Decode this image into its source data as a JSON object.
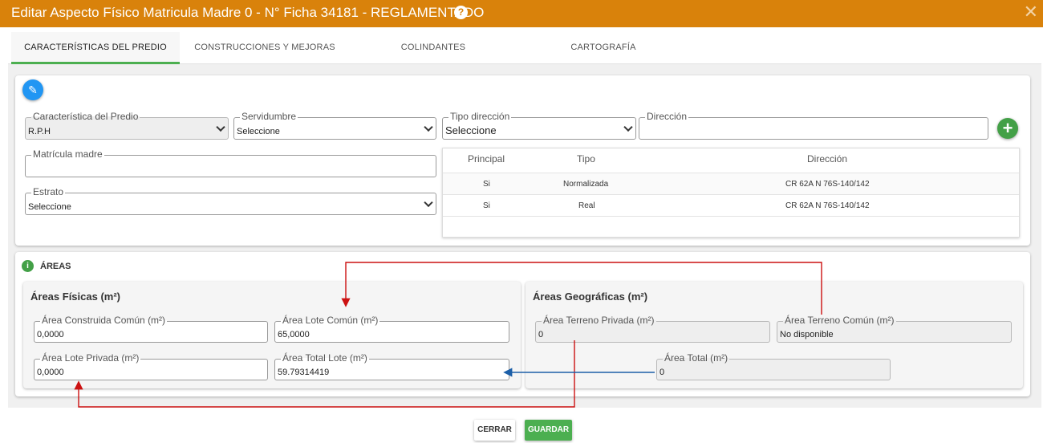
{
  "dialog": {
    "title": "Editar Aspecto Físico Matricula Madre 0 - N° Ficha 34181 - REGLAMENTADO",
    "help_glyph": "?",
    "close_glyph": "✕"
  },
  "tabs": [
    {
      "label": "CARACTERÍSTICAS DEL PREDIO",
      "active": true
    },
    {
      "label": "CONSTRUCCIONES Y MEJORAS",
      "active": false
    },
    {
      "label": "COLINDANTES",
      "active": false
    },
    {
      "label": "CARTOGRAFÍA",
      "active": false
    }
  ],
  "predio": {
    "edit_icon": "pencil-icon",
    "caracteristica": {
      "label": "Característica del Predio",
      "value": "R.P.H"
    },
    "servidumbre": {
      "label": "Servidumbre",
      "value": "Seleccione"
    },
    "tipo_direccion": {
      "label": "Tipo dirección",
      "value": "Seleccione"
    },
    "direccion": {
      "label": "Dirección",
      "value": ""
    },
    "add_glyph": "+",
    "matricula_madre": {
      "label": "Matrícula madre",
      "value": ""
    },
    "estrato": {
      "label": "Estrato",
      "value": "Seleccione"
    }
  },
  "address_table": {
    "columns": [
      "Principal",
      "Tipo",
      "Dirección"
    ],
    "rows": [
      {
        "principal": "Si",
        "tipo": "Normalizada",
        "direccion": "CR 62A N 76S-140/142"
      },
      {
        "principal": "Si",
        "tipo": "Real",
        "direccion": "CR 62A N 76S-140/142"
      }
    ]
  },
  "areas": {
    "section_title": "ÁREAS",
    "info_glyph": "i",
    "fisicas": {
      "title": "Áreas Físicas (m²)",
      "construida_comun": {
        "label": "Área Construida Común (m²)",
        "value": "0,0000"
      },
      "lote_comun": {
        "label": "Área Lote Común (m²)",
        "value": "65,0000"
      },
      "lote_privada": {
        "label": "Área Lote Privada (m²)",
        "value": "0,0000"
      },
      "total_lote": {
        "label": "Área Total Lote (m²)",
        "value": "59.79314419"
      }
    },
    "geograficas": {
      "title": "Áreas Geográficas (m²)",
      "terreno_privada": {
        "label": "Área Terreno Privada (m²)",
        "value": "0"
      },
      "terreno_comun": {
        "label": "Área Terreno Común (m²)",
        "value": "No disponible"
      },
      "total": {
        "label": "Área Total (m²)",
        "value": "0"
      }
    }
  },
  "footer": {
    "cerrar": "CERRAR",
    "guardar": "GUARDAR"
  },
  "colors": {
    "header": "#d9820b",
    "accent_green": "#4caf50",
    "edit_blue": "#2196f3",
    "annotation_red": "#cc1111",
    "annotation_blue": "#1c5fa8"
  }
}
